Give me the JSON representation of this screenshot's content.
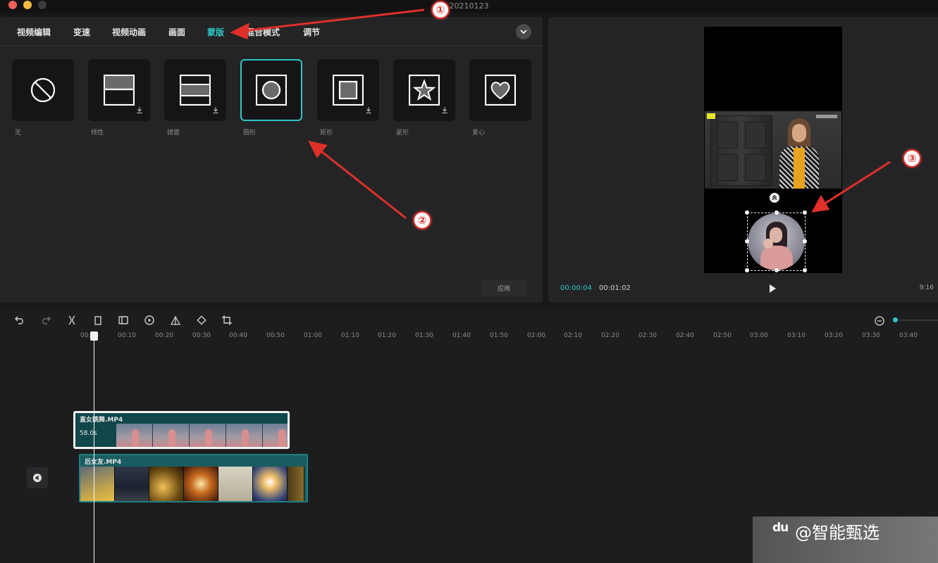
{
  "window": {
    "title": "20210123"
  },
  "tabs": [
    {
      "label": "视频编辑",
      "active": false
    },
    {
      "label": "变速",
      "active": false
    },
    {
      "label": "视频动画",
      "active": false
    },
    {
      "label": "画面",
      "active": false
    },
    {
      "label": "蒙版",
      "active": true
    },
    {
      "label": "混合模式",
      "active": false
    },
    {
      "label": "调节",
      "active": false
    }
  ],
  "masks": [
    {
      "label": "无",
      "icon": "no-mask-icon",
      "download": false,
      "selected": false
    },
    {
      "label": "线性",
      "icon": "linear-mask-icon",
      "download": true,
      "selected": false
    },
    {
      "label": "镜面",
      "icon": "mirror-mask-icon",
      "download": true,
      "selected": false
    },
    {
      "label": "圆形",
      "icon": "circle-mask-icon",
      "download": false,
      "selected": true
    },
    {
      "label": "矩形",
      "icon": "rectangle-mask-icon",
      "download": true,
      "selected": false
    },
    {
      "label": "星形",
      "icon": "star-mask-icon",
      "download": true,
      "selected": false
    },
    {
      "label": "爱心",
      "icon": "heart-mask-icon",
      "download": false,
      "selected": false
    }
  ],
  "apply_label": "应用",
  "preview": {
    "current_time": "00:00:04",
    "total_time": "00:01:02",
    "ratio": "9:16"
  },
  "toolbar": [
    {
      "name": "undo-icon"
    },
    {
      "name": "redo-icon"
    },
    {
      "name": "split-icon"
    },
    {
      "name": "delete-icon"
    },
    {
      "name": "freeze-icon"
    },
    {
      "name": "reverse-icon"
    },
    {
      "name": "mirror-icon"
    },
    {
      "name": "rotate-icon"
    },
    {
      "name": "crop-icon"
    }
  ],
  "ruler": [
    "00:00",
    "00:10",
    "00:20",
    "00:30",
    "00:40",
    "00:50",
    "01:00",
    "01:10",
    "01:20",
    "01:30",
    "01:40",
    "01:50",
    "02:00",
    "02:10",
    "02:20",
    "02:30",
    "02:40",
    "02:50",
    "03:00",
    "03:10",
    "03:20",
    "03:30",
    "03:40"
  ],
  "clips": {
    "top": {
      "title": "直女跳舞.MP4",
      "duration": "58.0s"
    },
    "main": {
      "title": "后女友.MP4"
    }
  },
  "annotations": [
    "①",
    "②",
    "③"
  ],
  "watermark": {
    "logo": "du",
    "text": "@智能甄选"
  },
  "colors": {
    "accent": "#2ec5c5",
    "annotation": "#e0302a",
    "panel": "#242426"
  }
}
